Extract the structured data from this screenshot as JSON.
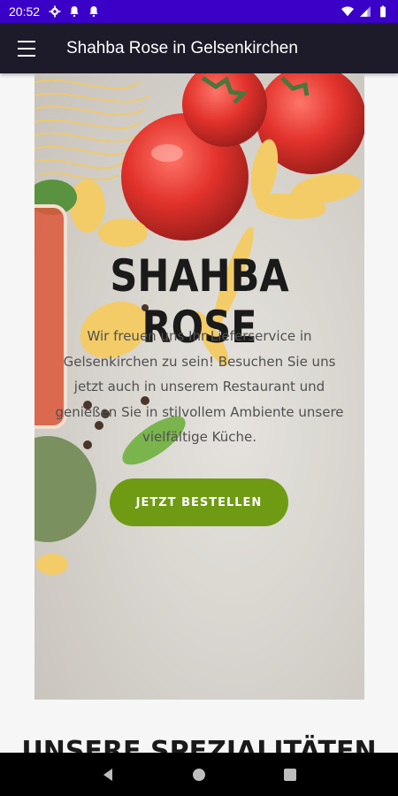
{
  "status_bar": {
    "time": "20:52",
    "left_icons": [
      "gear-icon",
      "bell-icon",
      "bell-icon"
    ],
    "right_icons": [
      "wifi-icon",
      "signal-icon",
      "battery-icon"
    ],
    "color": "#3a00c8"
  },
  "app_bar": {
    "title": "Shahba Rose in Gelsenkirchen",
    "menu_icon": "hamburger-menu-icon",
    "color": "#1d1b2a"
  },
  "hero": {
    "title": "SHAHBA ROSE",
    "text": "Wir freuen uns Ihr Lieferservice in Gelsenkirchen zu sein! Besuchen Sie uns jetzt auch in unserem Restaurant und genießen Sie in stilvollem Ambiente unsere vielfältige Küche.",
    "button_label": "JETZT BESTELLEN",
    "button_color": "#6f9b14"
  },
  "specialities": {
    "heading": "UNSERE SPEZIALITÄTEN"
  },
  "nav_bar": {
    "buttons": [
      "back-icon",
      "home-icon",
      "recents-icon"
    ]
  }
}
